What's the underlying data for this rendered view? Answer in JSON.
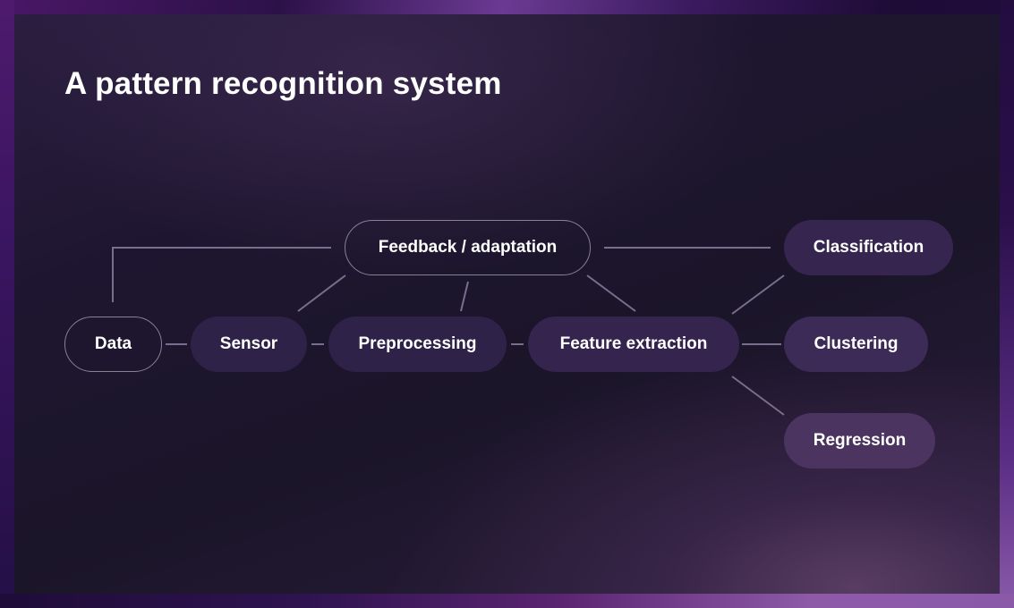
{
  "slide": {
    "title": "A pattern recognition system"
  },
  "diagram": {
    "nodes": [
      {
        "id": "data",
        "label": "Data",
        "style": "outline"
      },
      {
        "id": "sensor",
        "label": "Sensor",
        "style": "filled"
      },
      {
        "id": "preprocessing",
        "label": "Preprocessing",
        "style": "filled"
      },
      {
        "id": "feature_extraction",
        "label": "Feature extraction",
        "style": "filled"
      },
      {
        "id": "feedback",
        "label": "Feedback / adaptation",
        "style": "outline"
      },
      {
        "id": "classification",
        "label": "Classification",
        "style": "filled"
      },
      {
        "id": "clustering",
        "label": "Clustering",
        "style": "filled"
      },
      {
        "id": "regression",
        "label": "Regression",
        "style": "filled"
      }
    ],
    "edges": [
      {
        "from": "data",
        "to": "sensor"
      },
      {
        "from": "sensor",
        "to": "preprocessing"
      },
      {
        "from": "preprocessing",
        "to": "feature_extraction"
      },
      {
        "from": "feature_extraction",
        "to": "classification"
      },
      {
        "from": "feature_extraction",
        "to": "clustering"
      },
      {
        "from": "feature_extraction",
        "to": "regression"
      },
      {
        "from": "feedback",
        "to": "data"
      },
      {
        "from": "feedback",
        "to": "sensor"
      },
      {
        "from": "feedback",
        "to": "preprocessing"
      },
      {
        "from": "feedback",
        "to": "feature_extraction"
      },
      {
        "from": "feedback",
        "to": "classification"
      }
    ],
    "colors": {
      "edge": "#7a6e8e",
      "node_outline": "#8a8096",
      "node_fill": "#2f2248",
      "text": "#ffffff"
    }
  }
}
